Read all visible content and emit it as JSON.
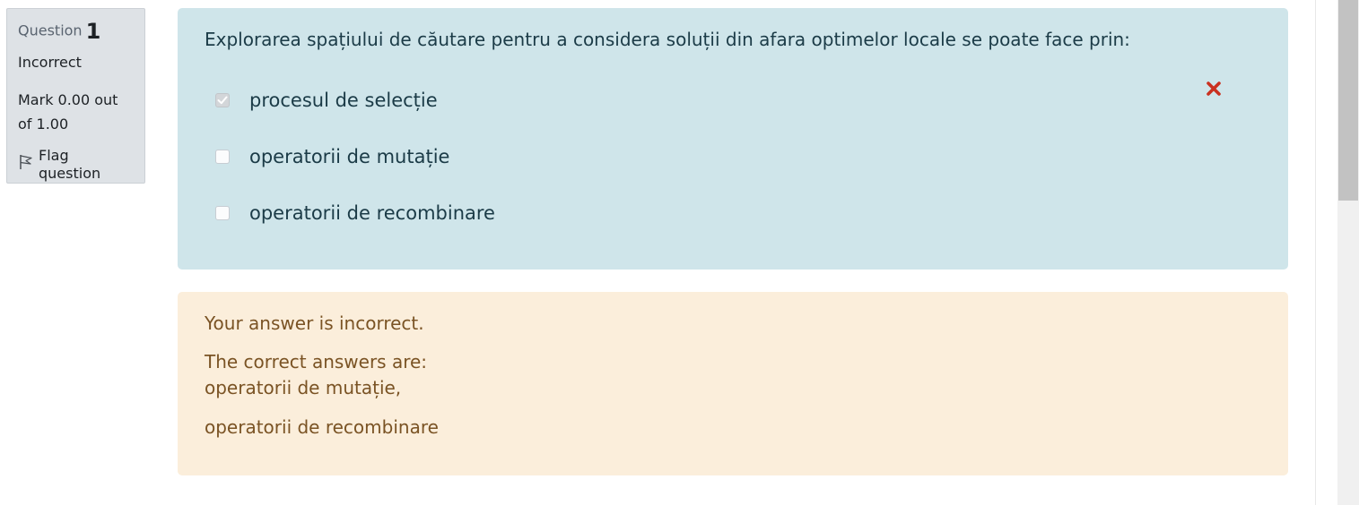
{
  "info": {
    "question_word": "Question",
    "question_number": "1",
    "state": "Incorrect",
    "grade": "Mark 0.00 out of 1.00",
    "flag_label": "Flag question"
  },
  "formulation": {
    "question_text": "Explorarea spațiului de căutare pentru a considera soluții din afara optimelor locale se poate face prin:",
    "options": [
      {
        "label": "procesul de selecție",
        "checked": true,
        "mark": "incorrect"
      },
      {
        "label": "operatorii de mutație",
        "checked": false
      },
      {
        "label": "operatorii de recombinare",
        "checked": false
      }
    ]
  },
  "outcome": {
    "feedback": "Your answer is incorrect.",
    "right_answer_intro": "The correct answers are:",
    "right_answers": [
      "operatorii de mutație,",
      "operatorii de recombinare"
    ]
  },
  "colors": {
    "info_bg": "#dee2e6",
    "formulation_bg": "#cfe5ea",
    "outcome_bg": "#fbeedb",
    "incorrect_icon": "#ca3120"
  },
  "icons": {
    "flag": "flag-icon",
    "incorrect": "cross-icon",
    "checkmark": "check-icon"
  }
}
